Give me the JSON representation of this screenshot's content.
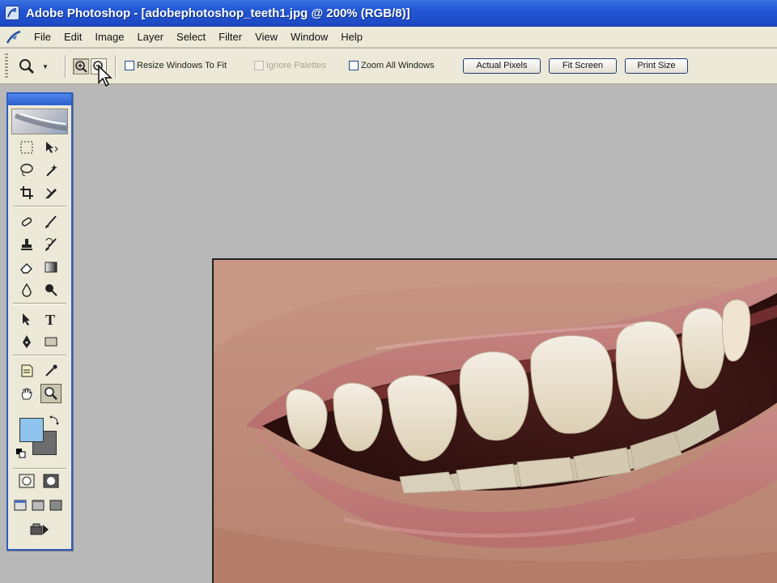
{
  "title_bar": {
    "text": "Adobe Photoshop - [adobephotoshop_teeth1.jpg @ 200% (RGB/8)]"
  },
  "menu": [
    "File",
    "Edit",
    "Image",
    "Layer",
    "Select",
    "Filter",
    "View",
    "Window",
    "Help"
  ],
  "options_bar": {
    "resize_windows_label": "Resize Windows To Fit",
    "ignore_palettes_label": "Ignore Palettes",
    "zoom_all_windows_label": "Zoom All Windows",
    "actual_pixels_label": "Actual Pixels",
    "fit_screen_label": "Fit Screen",
    "print_size_label": "Print Size"
  },
  "colors": {
    "foreground": "#8ec3ed",
    "background": "#6d6d6d",
    "canvas_bg": "#b8b8b8",
    "title_bar": "#2356d4"
  },
  "icons": {
    "active_tool": "zoom-tool-icon",
    "tools": [
      "marquee",
      "move",
      "lasso",
      "magic-wand",
      "crop",
      "slice",
      "healing-brush",
      "brush",
      "clone-stamp",
      "history-brush",
      "eraser",
      "gradient",
      "blur",
      "dodge",
      "path-selection",
      "type",
      "pen",
      "shape",
      "notes",
      "eyedropper",
      "hand",
      "zoom"
    ]
  }
}
